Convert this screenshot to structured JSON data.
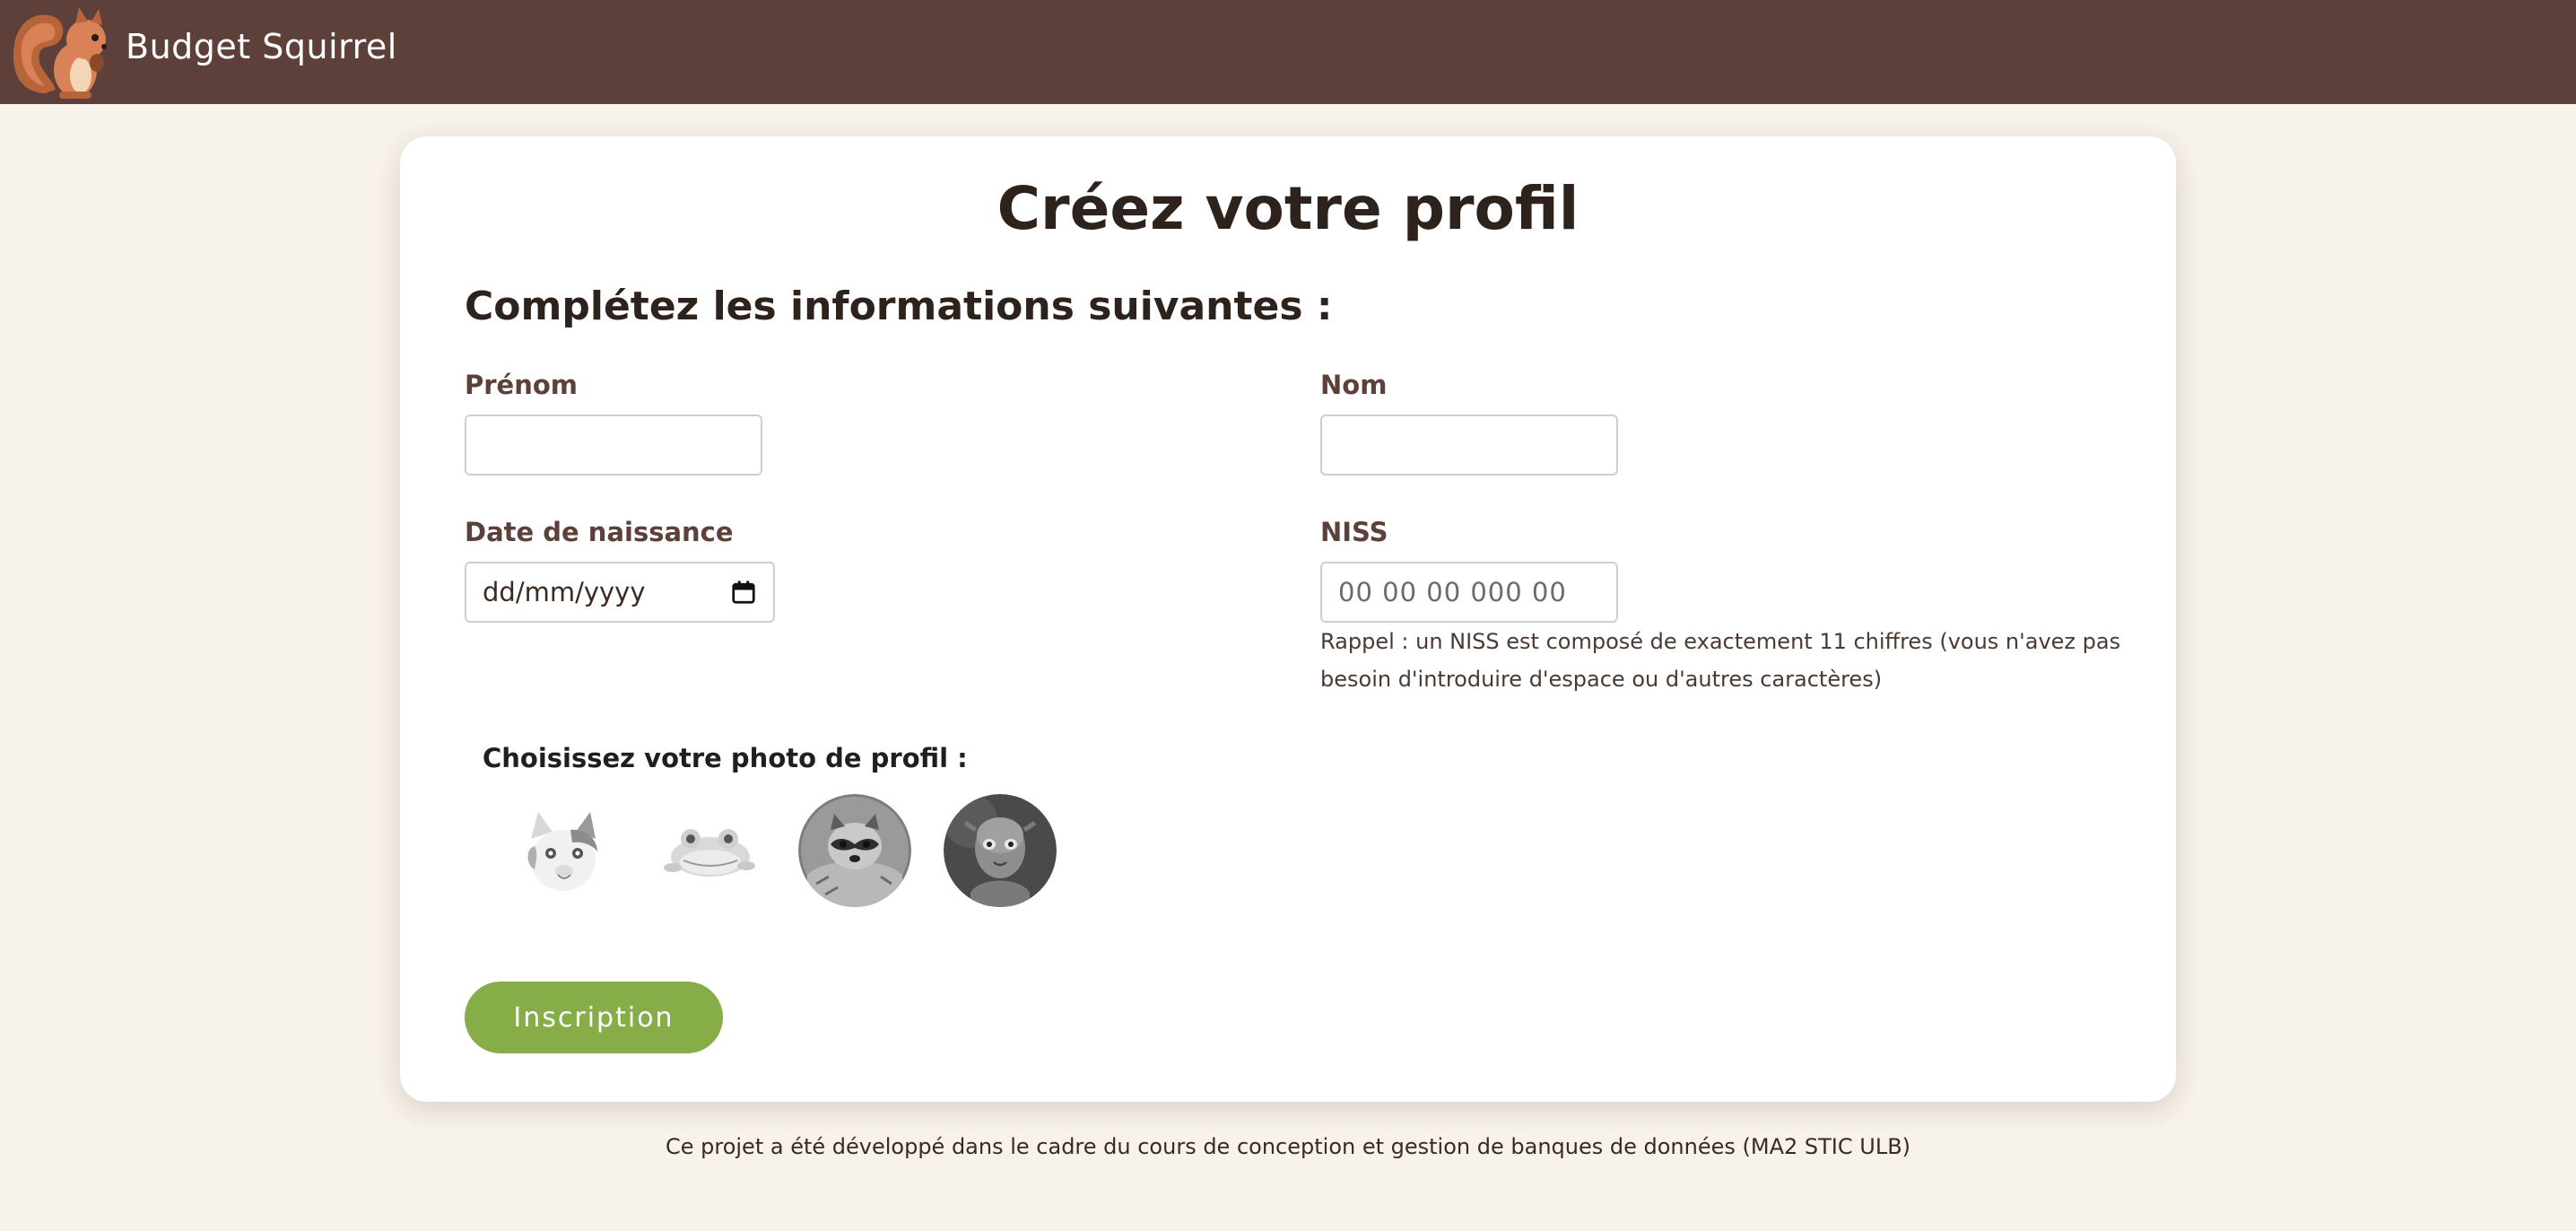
{
  "navbar": {
    "brand": "Budget Squirrel",
    "logo_icon": "squirrel-icon",
    "bg_color": "#5c4039"
  },
  "form": {
    "title": "Créez votre profil",
    "subtitle": "Complétez les informations suivantes :",
    "fields": {
      "prenom": {
        "label": "Prénom",
        "value": "",
        "placeholder": ""
      },
      "nom": {
        "label": "Nom",
        "value": "",
        "placeholder": ""
      },
      "date_naissance": {
        "label": "Date de naissance",
        "placeholder": "dd/mm/yyyy",
        "icon": "calendar-icon"
      },
      "niss": {
        "label": "NISS",
        "placeholder": "00 00 00 000 00",
        "hint": "Rappel : un NISS est composé de exactement 11 chiffres (vous n'avez pas besoin d'introduire d'espace ou d'autres caractères)"
      }
    },
    "photo_label": "Choisissez votre photo de profil :",
    "avatars": [
      "cat-avatar",
      "frog-avatar",
      "raccoon-avatar",
      "gollum-avatar"
    ],
    "submit_label": "Inscription",
    "submit_color": "#86ad47"
  },
  "footer": {
    "text": "Ce projet a été développé dans le cadre du cours de conception et gestion de banques de données (MA2 STIC ULB)"
  }
}
